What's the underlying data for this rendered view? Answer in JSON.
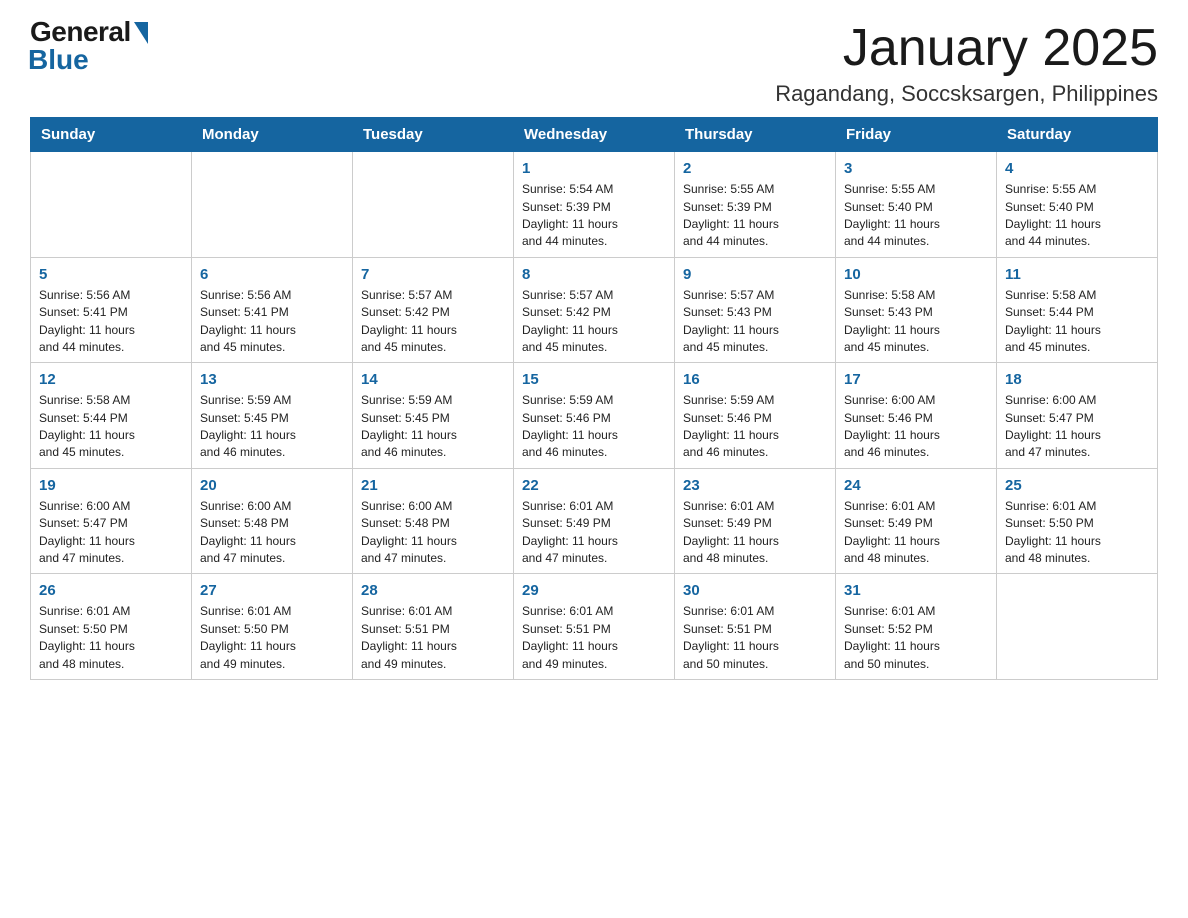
{
  "header": {
    "logo_general": "General",
    "logo_blue": "Blue",
    "title": "January 2025",
    "subtitle": "Ragandang, Soccsksargen, Philippines"
  },
  "days": [
    "Sunday",
    "Monday",
    "Tuesday",
    "Wednesday",
    "Thursday",
    "Friday",
    "Saturday"
  ],
  "weeks": [
    [
      {
        "day": "",
        "info": ""
      },
      {
        "day": "",
        "info": ""
      },
      {
        "day": "",
        "info": ""
      },
      {
        "day": "1",
        "info": "Sunrise: 5:54 AM\nSunset: 5:39 PM\nDaylight: 11 hours\nand 44 minutes."
      },
      {
        "day": "2",
        "info": "Sunrise: 5:55 AM\nSunset: 5:39 PM\nDaylight: 11 hours\nand 44 minutes."
      },
      {
        "day": "3",
        "info": "Sunrise: 5:55 AM\nSunset: 5:40 PM\nDaylight: 11 hours\nand 44 minutes."
      },
      {
        "day": "4",
        "info": "Sunrise: 5:55 AM\nSunset: 5:40 PM\nDaylight: 11 hours\nand 44 minutes."
      }
    ],
    [
      {
        "day": "5",
        "info": "Sunrise: 5:56 AM\nSunset: 5:41 PM\nDaylight: 11 hours\nand 44 minutes."
      },
      {
        "day": "6",
        "info": "Sunrise: 5:56 AM\nSunset: 5:41 PM\nDaylight: 11 hours\nand 45 minutes."
      },
      {
        "day": "7",
        "info": "Sunrise: 5:57 AM\nSunset: 5:42 PM\nDaylight: 11 hours\nand 45 minutes."
      },
      {
        "day": "8",
        "info": "Sunrise: 5:57 AM\nSunset: 5:42 PM\nDaylight: 11 hours\nand 45 minutes."
      },
      {
        "day": "9",
        "info": "Sunrise: 5:57 AM\nSunset: 5:43 PM\nDaylight: 11 hours\nand 45 minutes."
      },
      {
        "day": "10",
        "info": "Sunrise: 5:58 AM\nSunset: 5:43 PM\nDaylight: 11 hours\nand 45 minutes."
      },
      {
        "day": "11",
        "info": "Sunrise: 5:58 AM\nSunset: 5:44 PM\nDaylight: 11 hours\nand 45 minutes."
      }
    ],
    [
      {
        "day": "12",
        "info": "Sunrise: 5:58 AM\nSunset: 5:44 PM\nDaylight: 11 hours\nand 45 minutes."
      },
      {
        "day": "13",
        "info": "Sunrise: 5:59 AM\nSunset: 5:45 PM\nDaylight: 11 hours\nand 46 minutes."
      },
      {
        "day": "14",
        "info": "Sunrise: 5:59 AM\nSunset: 5:45 PM\nDaylight: 11 hours\nand 46 minutes."
      },
      {
        "day": "15",
        "info": "Sunrise: 5:59 AM\nSunset: 5:46 PM\nDaylight: 11 hours\nand 46 minutes."
      },
      {
        "day": "16",
        "info": "Sunrise: 5:59 AM\nSunset: 5:46 PM\nDaylight: 11 hours\nand 46 minutes."
      },
      {
        "day": "17",
        "info": "Sunrise: 6:00 AM\nSunset: 5:46 PM\nDaylight: 11 hours\nand 46 minutes."
      },
      {
        "day": "18",
        "info": "Sunrise: 6:00 AM\nSunset: 5:47 PM\nDaylight: 11 hours\nand 47 minutes."
      }
    ],
    [
      {
        "day": "19",
        "info": "Sunrise: 6:00 AM\nSunset: 5:47 PM\nDaylight: 11 hours\nand 47 minutes."
      },
      {
        "day": "20",
        "info": "Sunrise: 6:00 AM\nSunset: 5:48 PM\nDaylight: 11 hours\nand 47 minutes."
      },
      {
        "day": "21",
        "info": "Sunrise: 6:00 AM\nSunset: 5:48 PM\nDaylight: 11 hours\nand 47 minutes."
      },
      {
        "day": "22",
        "info": "Sunrise: 6:01 AM\nSunset: 5:49 PM\nDaylight: 11 hours\nand 47 minutes."
      },
      {
        "day": "23",
        "info": "Sunrise: 6:01 AM\nSunset: 5:49 PM\nDaylight: 11 hours\nand 48 minutes."
      },
      {
        "day": "24",
        "info": "Sunrise: 6:01 AM\nSunset: 5:49 PM\nDaylight: 11 hours\nand 48 minutes."
      },
      {
        "day": "25",
        "info": "Sunrise: 6:01 AM\nSunset: 5:50 PM\nDaylight: 11 hours\nand 48 minutes."
      }
    ],
    [
      {
        "day": "26",
        "info": "Sunrise: 6:01 AM\nSunset: 5:50 PM\nDaylight: 11 hours\nand 48 minutes."
      },
      {
        "day": "27",
        "info": "Sunrise: 6:01 AM\nSunset: 5:50 PM\nDaylight: 11 hours\nand 49 minutes."
      },
      {
        "day": "28",
        "info": "Sunrise: 6:01 AM\nSunset: 5:51 PM\nDaylight: 11 hours\nand 49 minutes."
      },
      {
        "day": "29",
        "info": "Sunrise: 6:01 AM\nSunset: 5:51 PM\nDaylight: 11 hours\nand 49 minutes."
      },
      {
        "day": "30",
        "info": "Sunrise: 6:01 AM\nSunset: 5:51 PM\nDaylight: 11 hours\nand 50 minutes."
      },
      {
        "day": "31",
        "info": "Sunrise: 6:01 AM\nSunset: 5:52 PM\nDaylight: 11 hours\nand 50 minutes."
      },
      {
        "day": "",
        "info": ""
      }
    ]
  ]
}
